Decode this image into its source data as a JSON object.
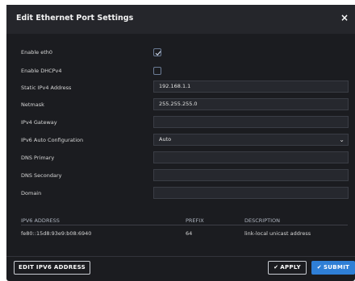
{
  "dialog": {
    "title": "Edit Ethernet Port Settings",
    "close_glyph": "×"
  },
  "form": {
    "enable_eth0": {
      "label": "Enable eth0",
      "checked": true
    },
    "enable_dhcpv4": {
      "label": "Enable DHCPv4",
      "checked": false
    },
    "static_ipv4": {
      "label": "Static IPv4 Address",
      "value": "192.168.1.1"
    },
    "netmask": {
      "label": "Netmask",
      "value": "255.255.255.0"
    },
    "ipv4_gateway": {
      "label": "IPv4 Gateway",
      "value": ""
    },
    "ipv6_auto": {
      "label": "IPv6 Auto Configuration",
      "value": "Auto"
    },
    "dns_primary": {
      "label": "DNS Primary",
      "value": ""
    },
    "dns_secondary": {
      "label": "DNS Secondary",
      "value": ""
    },
    "domain": {
      "label": "Domain",
      "value": ""
    }
  },
  "ipv6_table": {
    "headers": [
      "IPV6 ADDRESS",
      "PREFIX",
      "DESCRIPTION"
    ],
    "rows": [
      [
        "fe80::15d8:93e9:b08:6940",
        "64",
        "link-local unicast address"
      ]
    ]
  },
  "footer": {
    "edit_ipv6_label": "EDIT IPV6 ADDRESS",
    "apply_label": "APPLY",
    "submit_label": "SUBMIT"
  },
  "icons": {
    "check": "check-icon",
    "close": "close-icon",
    "chevron": "chevron-down-icon"
  },
  "colors": {
    "dialog_bg": "#1b1c20",
    "primary": "#2f7fd6",
    "checkbox_border": "#6b7b95"
  }
}
